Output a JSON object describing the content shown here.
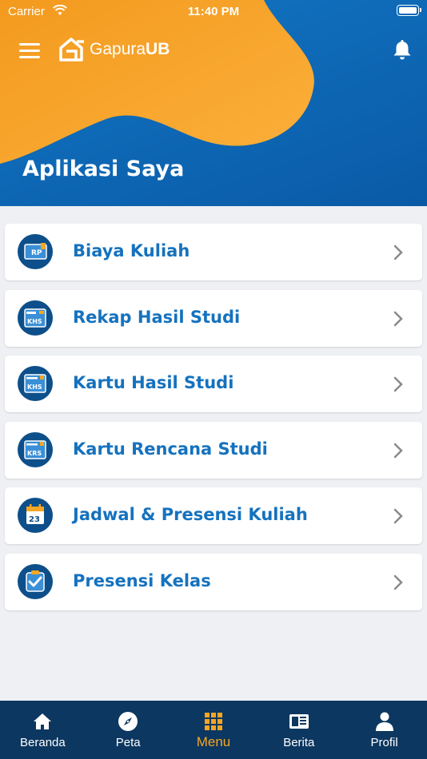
{
  "status_bar": {
    "carrier": "Carrier",
    "time": "11:40 PM"
  },
  "header": {
    "logo_text_regular": "Gapura",
    "logo_text_bold": "UB",
    "page_title": "Aplikasi Saya"
  },
  "colors": {
    "primary": "#0a6cb8",
    "accent": "#f5a623",
    "navbar": "#0c3760",
    "label": "#1572be"
  },
  "menu_items": [
    {
      "label": "Biaya Kuliah",
      "icon": "payment-icon"
    },
    {
      "label": "Rekap Hasil Studi",
      "icon": "study-recap-icon"
    },
    {
      "label": "Kartu Hasil Studi",
      "icon": "khs-card-icon"
    },
    {
      "label": "Kartu Rencana Studi",
      "icon": "krs-card-icon"
    },
    {
      "label": "Jadwal & Presensi Kuliah",
      "icon": "calendar-icon"
    },
    {
      "label": "Presensi Kelas",
      "icon": "checklist-icon"
    }
  ],
  "tabs": [
    {
      "label": "Beranda",
      "icon": "home-icon"
    },
    {
      "label": "Peta",
      "icon": "compass-icon"
    },
    {
      "label": "Menu",
      "icon": "grid-icon",
      "active": true
    },
    {
      "label": "Berita",
      "icon": "newspaper-icon"
    },
    {
      "label": "Profil",
      "icon": "person-icon"
    }
  ],
  "icon_text": {
    "rp": "RP",
    "khs": "KHS",
    "krs": "KRS",
    "day": "23"
  }
}
